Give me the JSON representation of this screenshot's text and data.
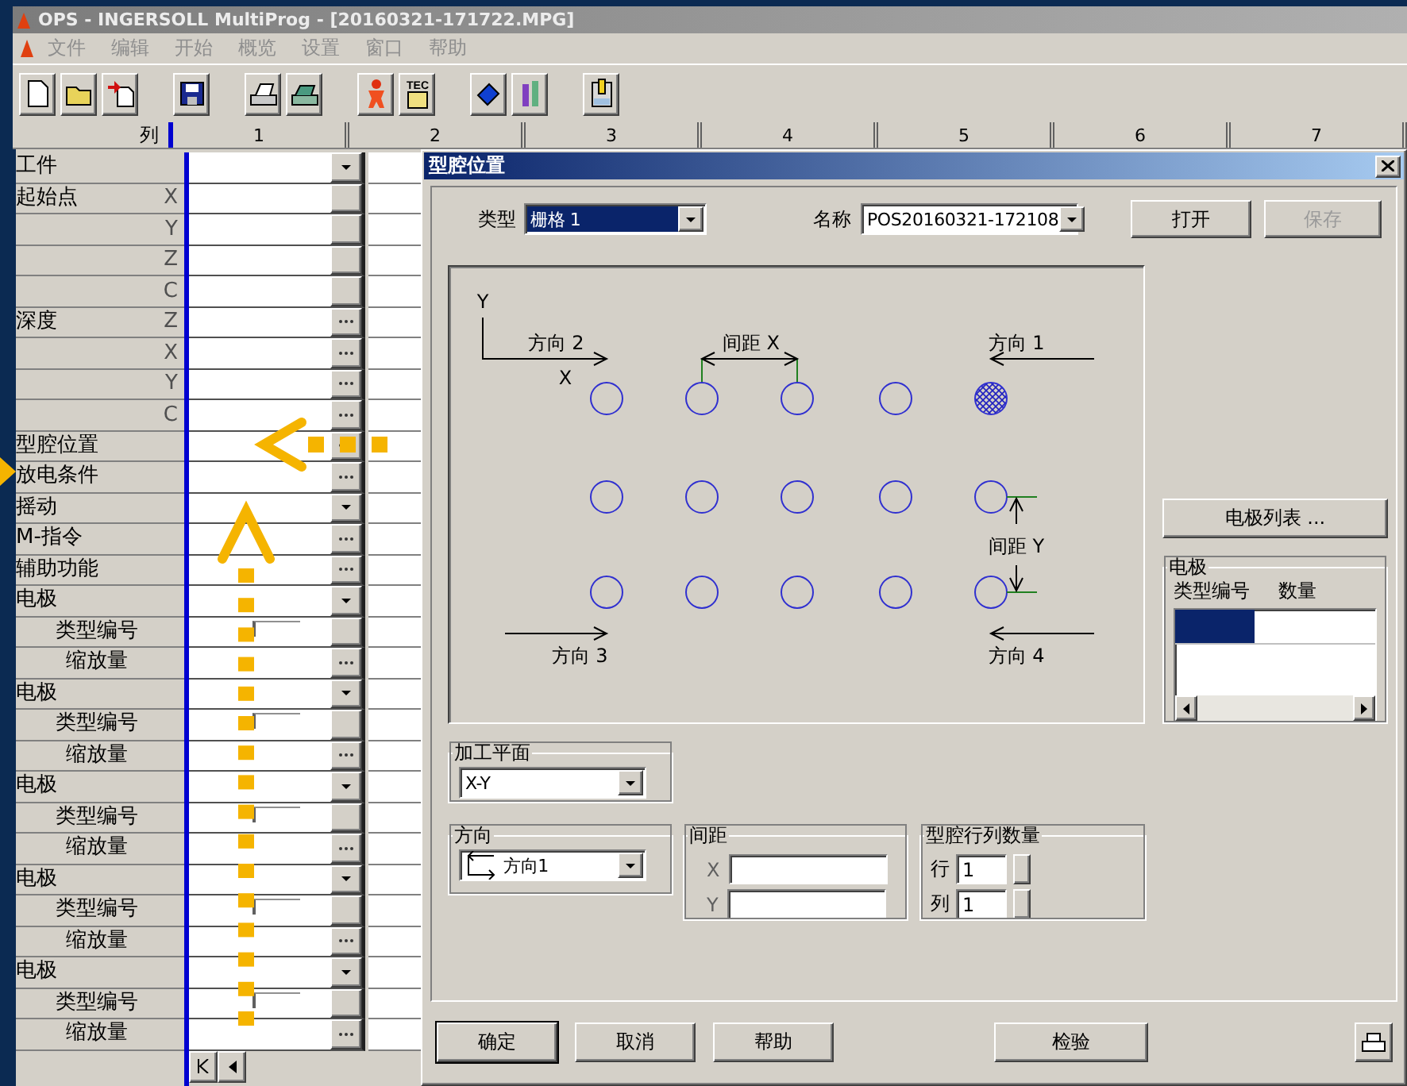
{
  "window": {
    "title": "OPS - INGERSOLL MultiProg - [20160321-171722.MPG]"
  },
  "menu": [
    {
      "label": "文件",
      "disabled": true
    },
    {
      "label": "编辑",
      "disabled": true
    },
    {
      "label": "开始",
      "disabled": true
    },
    {
      "label": "概览",
      "disabled": true
    },
    {
      "label": "设置",
      "disabled": true
    },
    {
      "label": "窗口",
      "disabled": true
    },
    {
      "label": "帮助",
      "disabled": true
    }
  ],
  "toolbar": [
    [
      {
        "kind": "new"
      },
      {
        "kind": "open"
      },
      {
        "kind": "import"
      }
    ],
    [
      {
        "kind": "save"
      }
    ],
    [
      {
        "kind": "print"
      },
      {
        "kind": "scan"
      }
    ],
    [
      {
        "kind": "figure"
      },
      {
        "kind": "tec",
        "text": "TEC"
      }
    ],
    [
      {
        "kind": "eraser"
      },
      {
        "kind": "bars"
      }
    ],
    [
      {
        "kind": "machine"
      }
    ]
  ],
  "grid": {
    "corner": "列",
    "columns": [
      "1",
      "2",
      "3",
      "4",
      "5",
      "6",
      "7"
    ],
    "rows": [
      {
        "label": "工件",
        "kind": "dropdown"
      },
      {
        "label": "起始点",
        "axes": [
          {
            "axis": "X",
            "kind": "blank"
          },
          {
            "axis": "Y",
            "kind": "blank"
          },
          {
            "axis": "Z",
            "kind": "blank"
          },
          {
            "axis": "C",
            "kind": "blank"
          }
        ]
      },
      {
        "label": "深度",
        "axes": [
          {
            "axis": "Z",
            "kind": "ellipsis"
          },
          {
            "axis": "X",
            "kind": "ellipsis"
          },
          {
            "axis": "Y",
            "kind": "ellipsis"
          },
          {
            "axis": "C",
            "kind": "ellipsis"
          }
        ]
      },
      {
        "label": "型腔位置",
        "kind": "ellipsis"
      },
      {
        "label": "放电条件",
        "kind": "ellipsis"
      },
      {
        "label": "摇动",
        "kind": "dropdown"
      },
      {
        "label": "M-指令",
        "kind": "ellipsis"
      },
      {
        "label": "辅助功能",
        "kind": "ellipsis"
      },
      {
        "label": "电极",
        "kind": "dropdown",
        "children": [
          {
            "label": "类型编号",
            "kind": "split"
          },
          {
            "label": "缩放量",
            "kind": "ellipsis"
          }
        ]
      },
      {
        "label": "电极",
        "kind": "dropdown",
        "children": [
          {
            "label": "类型编号",
            "kind": "split"
          },
          {
            "label": "缩放量",
            "kind": "ellipsis"
          }
        ]
      },
      {
        "label": "电极",
        "kind": "dropdown",
        "children": [
          {
            "label": "类型编号",
            "kind": "split"
          },
          {
            "label": "缩放量",
            "kind": "ellipsis"
          }
        ]
      },
      {
        "label": "电极",
        "kind": "dropdown",
        "children": [
          {
            "label": "类型编号",
            "kind": "split"
          },
          {
            "label": "缩放量",
            "kind": "ellipsis"
          }
        ]
      },
      {
        "label": "电极",
        "kind": "dropdown",
        "children": [
          {
            "label": "类型编号",
            "kind": "split"
          },
          {
            "label": "缩放量",
            "kind": "ellipsis"
          }
        ]
      }
    ]
  },
  "dialog": {
    "title": "型腔位置",
    "type": {
      "label": "类型",
      "value": "栅格 1",
      "focused": true
    },
    "name": {
      "label": "名称",
      "value": "POS20160321-172108",
      "focused": false
    },
    "top_buttons": [
      {
        "label": "打开",
        "disabled": false
      },
      {
        "label": "保存",
        "disabled": true
      }
    ],
    "diagram": {
      "start_marked": true,
      "y_axis": "Y",
      "x_axis": "X",
      "dir1": "方向 1",
      "dir2": "方向 2",
      "dir3": "方向 3",
      "dir4": "方向 4",
      "pitch_x": "间距 X",
      "pitch_y": "间距 Y"
    },
    "electrode_list_button": "电极列表 ...",
    "electrodes": {
      "title": "电极",
      "columns": [
        "类型编号",
        "数量"
      ],
      "rows": [
        {
          "selected": true
        }
      ]
    },
    "plane": {
      "title": "加工平面",
      "value": "X-Y"
    },
    "direction": {
      "title": "方向",
      "value": "方向1"
    },
    "pitch": {
      "title": "间距",
      "fields": [
        {
          "label": "X"
        },
        {
          "label": "Y"
        }
      ]
    },
    "counts": {
      "title": "型腔行列数量",
      "fields": [
        {
          "label": "行",
          "value": "1"
        },
        {
          "label": "列",
          "value": "1"
        }
      ]
    },
    "buttons": [
      {
        "label": "确定",
        "default": true
      },
      {
        "label": "取消",
        "default": false
      },
      {
        "label": "帮助",
        "default": false
      },
      {
        "label": "检验",
        "default": false
      }
    ]
  },
  "annotations": [
    {
      "kind": "arrow-left"
    },
    {
      "kind": "arrow-up"
    },
    {
      "kind": "pointer"
    }
  ]
}
